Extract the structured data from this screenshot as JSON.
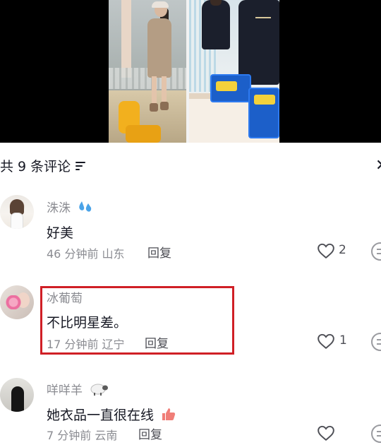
{
  "header": {
    "comment_count_label": "共 9 条评论",
    "filter_icon": "filter-lines-icon",
    "close_icon": "close-icon"
  },
  "comments": [
    {
      "username": "洙洙",
      "username_emoji": "sweat-droplets",
      "text": "好美",
      "time_location": "46 分钟前  山东",
      "reply_label": "回复",
      "likes": "2"
    },
    {
      "username": "冰葡萄",
      "text": "不比明星差。",
      "time_location": "17 分钟前  辽宁",
      "reply_label": "回复",
      "likes": "1",
      "highlighted": true
    },
    {
      "username": "咩咩羊",
      "username_emoji": "sheep",
      "text": "她衣品一直很在线",
      "text_emoji": "thumbs-up",
      "time_location": "7 分钟前  云南",
      "reply_label": "回复",
      "likes": ""
    }
  ],
  "colors": {
    "primary_text": "#161823",
    "secondary_text": "#8a8b91",
    "highlight_border": "#d01f26",
    "sweat_droplets": "#4aa3e8",
    "thumbs_up": "#f07e78"
  }
}
